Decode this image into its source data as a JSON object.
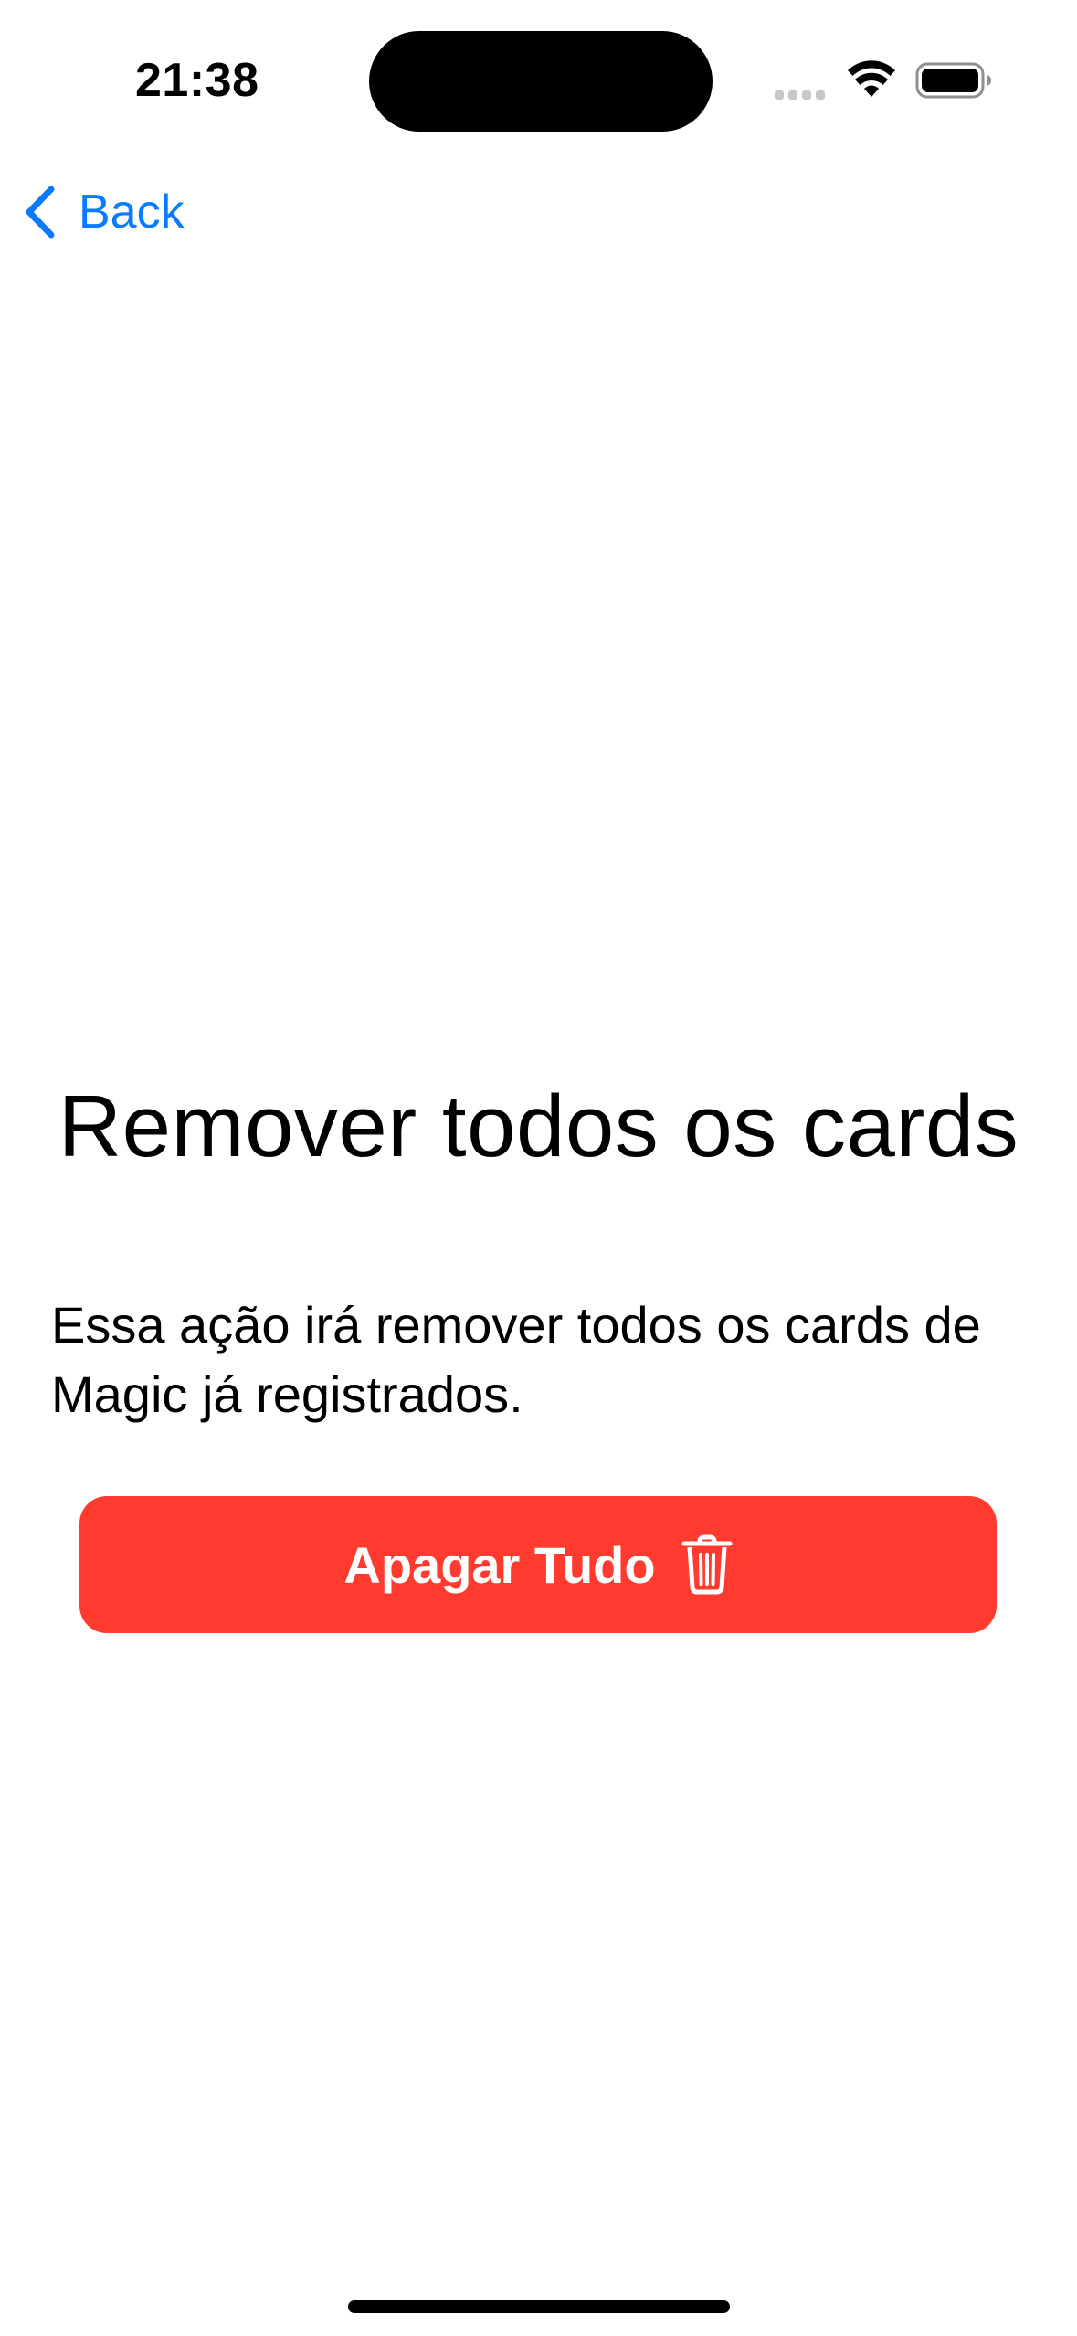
{
  "status_bar": {
    "time": "21:38",
    "icons": [
      "cell-signal-icon",
      "wifi-icon",
      "battery-icon"
    ]
  },
  "nav": {
    "back_label": "Back",
    "back_icon": "chevron-left-icon"
  },
  "main": {
    "title": "Remover todos os cards",
    "description": "Essa ação irá remover todos os cards de Magic já registrados.",
    "delete_button_label": "Apagar Tudo",
    "delete_button_icon": "trash-icon"
  },
  "colors": {
    "accent": "#0a7aff",
    "destructive": "#ff3b30",
    "background": "#ffffff",
    "text": "#000000"
  }
}
